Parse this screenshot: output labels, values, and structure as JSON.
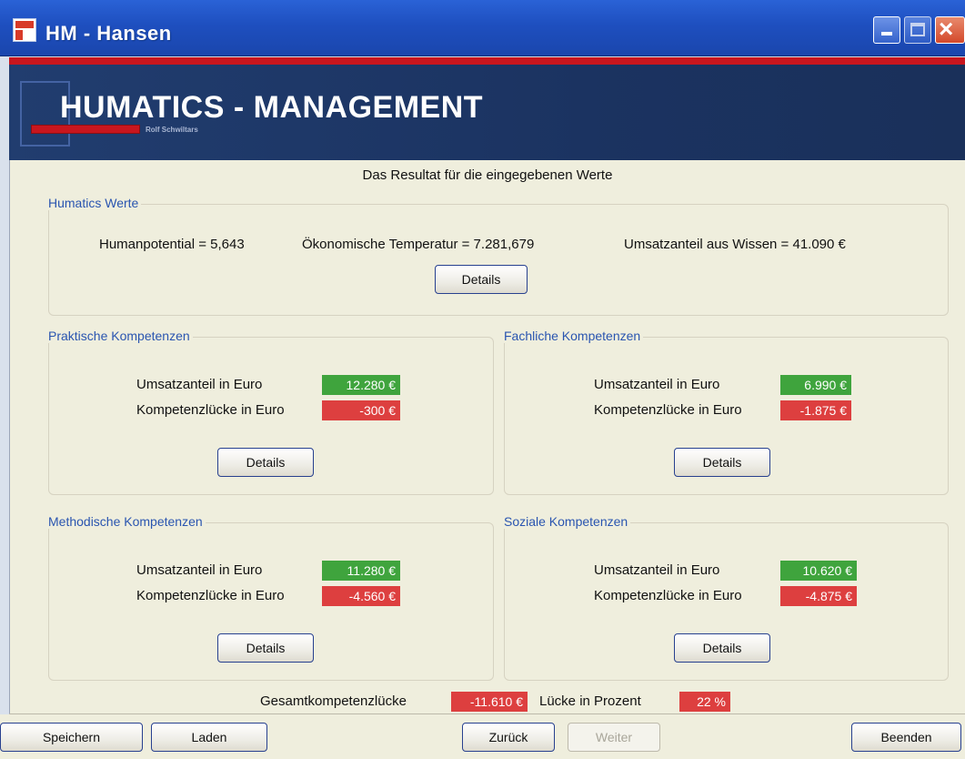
{
  "window": {
    "title": "HM - Hansen"
  },
  "banner": {
    "title": "HUMATICS - MANAGEMENT",
    "subtitle": "Rolf Schwiltars"
  },
  "heading": "Das Resultat für die eingegebenen Werte",
  "humatics": {
    "label": "Humatics Werte",
    "humanpotential": "Humanpotential = 5,643",
    "temperatur": "Ökonomische Temperatur = 7.281,679",
    "umsatzanteil": "Umsatzanteil aus Wissen = 41.090 €",
    "details": "Details"
  },
  "row_labels": {
    "umsatz": "Umsatzanteil in Euro",
    "luecke": "Kompetenzlücke in Euro"
  },
  "groups": {
    "praktisch": {
      "label": "Praktische Kompetenzen",
      "umsatz": "12.280 €",
      "luecke": "-300 €",
      "details": "Details"
    },
    "fachlich": {
      "label": "Fachliche Kompetenzen",
      "umsatz": "6.990 €",
      "luecke": "-1.875 €",
      "details": "Details"
    },
    "methodisch": {
      "label": "Methodische Kompetenzen",
      "umsatz": "11.280 €",
      "luecke": "-4.560 €",
      "details": "Details"
    },
    "sozial": {
      "label": "Soziale Kompetenzen",
      "umsatz": "10.620 €",
      "luecke": "-4.875 €",
      "details": "Details"
    }
  },
  "summary": {
    "gesamt_label": "Gesamtkompetenzlücke",
    "gesamt_value": "-11.610 €",
    "prozent_label": "Lücke in Prozent",
    "prozent_value": "22 %"
  },
  "footer": {
    "speichern": "Speichern",
    "laden": "Laden",
    "zurueck": "Zurück",
    "weiter": "Weiter",
    "beenden": "Beenden"
  },
  "colors": {
    "positive": "#3fa43d",
    "negative": "#dd3f3f",
    "accent_red": "#c8161e",
    "title_blue": "#1e4fbf",
    "group_label": "#2a55b0"
  }
}
